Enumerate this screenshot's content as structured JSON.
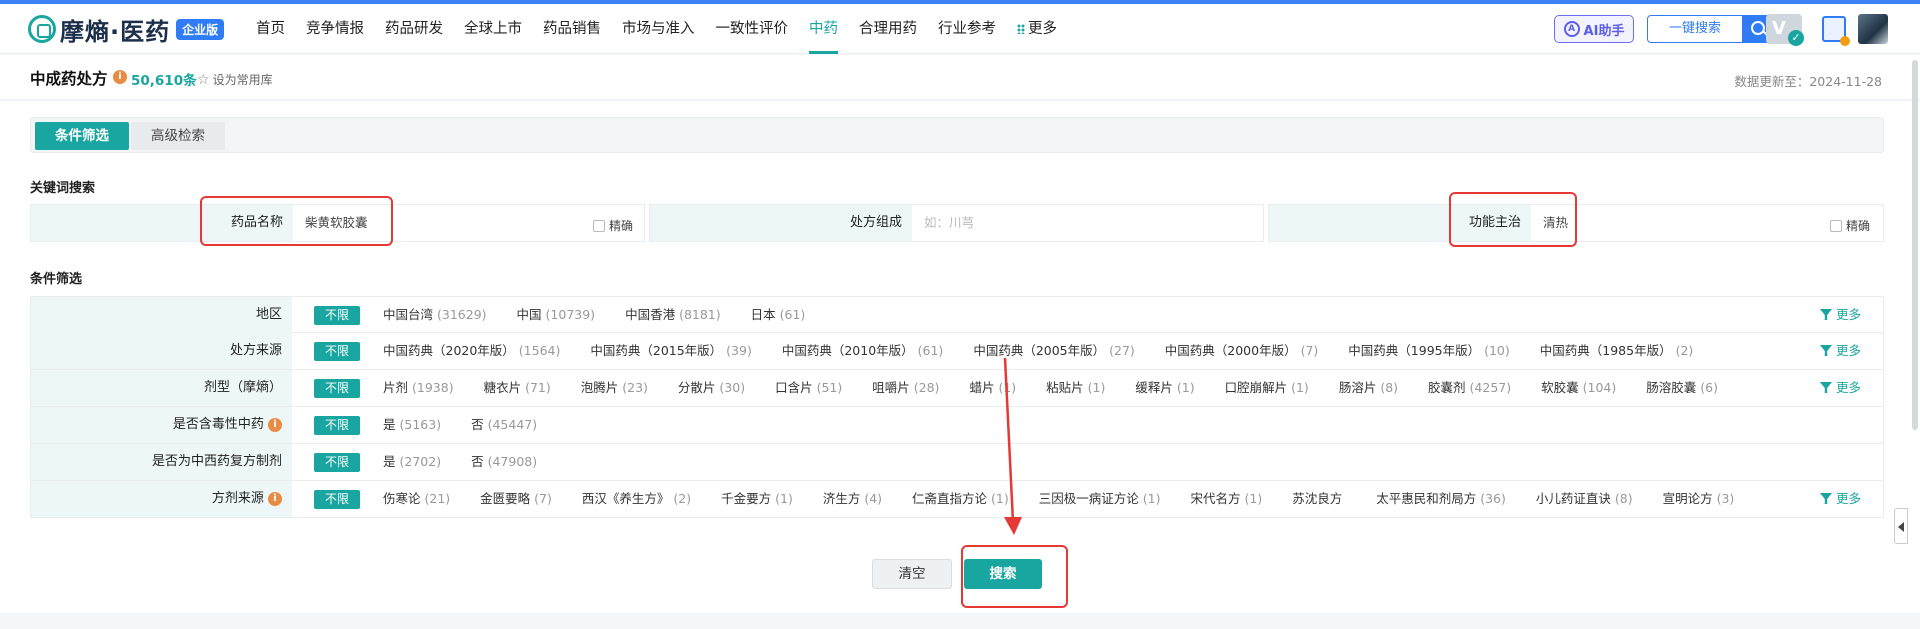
{
  "brand": {
    "name": "摩熵·医药",
    "edition": "企业版"
  },
  "nav": {
    "items": [
      "首页",
      "竞争情报",
      "药品研发",
      "全球上市",
      "药品销售",
      "市场与准入",
      "一致性评价",
      "中药",
      "合理用药",
      "行业参考"
    ],
    "active_index": 7,
    "more_label": "更多"
  },
  "tools": {
    "ai_label": "AI助手",
    "search_label": "一键搜索",
    "vip_label": "V"
  },
  "header": {
    "title": "中成药处方",
    "count": "50,610条",
    "favorite_label": "设为常用库",
    "update_text": "数据更新至：2024-11-28"
  },
  "tabs": [
    "条件筛选",
    "高级检索"
  ],
  "keyword_section": {
    "heading": "关键词搜索",
    "fields": [
      {
        "label": "药品名称",
        "value": "柴黄软胶囊",
        "exact_label": "精确"
      },
      {
        "label": "处方组成",
        "placeholder": "如：川芎"
      },
      {
        "label": "功能主治",
        "value": "清热",
        "exact_label": "精确"
      }
    ]
  },
  "filter_section": {
    "heading": "条件筛选",
    "unlimited_label": "不限",
    "more_label": "更多",
    "rows": [
      {
        "label": "地区",
        "info": false,
        "more": true,
        "options": [
          {
            "name": "中国台湾",
            "count": "(31629)"
          },
          {
            "name": "中国",
            "count": "(10739)"
          },
          {
            "name": "中国香港",
            "count": "(8181)"
          },
          {
            "name": "日本",
            "count": "(61)"
          }
        ]
      },
      {
        "label": "处方来源",
        "info": false,
        "more": true,
        "options": [
          {
            "name": "中国药典（2020年版）",
            "count": "(1564)"
          },
          {
            "name": "中国药典（2015年版）",
            "count": "(39)"
          },
          {
            "name": "中国药典（2010年版）",
            "count": "(61)"
          },
          {
            "name": "中国药典（2005年版）",
            "count": "(27)"
          },
          {
            "name": "中国药典（2000年版）",
            "count": "(7)"
          },
          {
            "name": "中国药典（1995年版）",
            "count": "(10)"
          },
          {
            "name": "中国药典（1985年版）",
            "count": "(2)"
          }
        ]
      },
      {
        "label": "剂型（摩熵）",
        "info": false,
        "more": true,
        "options": [
          {
            "name": "片剂",
            "count": "(1938)"
          },
          {
            "name": "糖衣片",
            "count": "(71)"
          },
          {
            "name": "泡腾片",
            "count": "(23)"
          },
          {
            "name": "分散片",
            "count": "(30)"
          },
          {
            "name": "口含片",
            "count": "(51)"
          },
          {
            "name": "咀嚼片",
            "count": "(28)"
          },
          {
            "name": "蜡片",
            "count": "(1)"
          },
          {
            "name": "粘贴片",
            "count": "(1)"
          },
          {
            "name": "缓释片",
            "count": "(1)"
          },
          {
            "name": "口腔崩解片",
            "count": "(1)"
          },
          {
            "name": "肠溶片",
            "count": "(8)"
          },
          {
            "name": "胶囊剂",
            "count": "(4257)"
          },
          {
            "name": "软胶囊",
            "count": "(104)"
          },
          {
            "name": "肠溶胶囊",
            "count": "(6)"
          }
        ]
      },
      {
        "label": "是否含毒性中药",
        "info": true,
        "more": false,
        "options": [
          {
            "name": "是",
            "count": "(5163)"
          },
          {
            "name": "否",
            "count": "(45447)"
          }
        ]
      },
      {
        "label": "是否为中西药复方制剂",
        "info": false,
        "more": false,
        "options": [
          {
            "name": "是",
            "count": "(2702)"
          },
          {
            "name": "否",
            "count": "(47908)"
          }
        ]
      },
      {
        "label": "方剂来源",
        "info": true,
        "more": true,
        "options": [
          {
            "name": "伤寒论",
            "count": "(21)"
          },
          {
            "name": "金匮要略",
            "count": "(7)"
          },
          {
            "name": "西汉《养生方》",
            "count": "(2)"
          },
          {
            "name": "千金要方",
            "count": "(1)"
          },
          {
            "name": "济生方",
            "count": "(4)"
          },
          {
            "name": "仁斋直指方论",
            "count": "(1)"
          },
          {
            "name": "三因极一病证方论",
            "count": "(1)"
          },
          {
            "name": "宋代名方",
            "count": "(1)"
          },
          {
            "name": "苏沈良方",
            "count": ""
          },
          {
            "name": "太平惠民和剂局方",
            "count": "(36)"
          },
          {
            "name": "小儿药证直诀",
            "count": "(8)"
          },
          {
            "name": "宣明论方",
            "count": "(3)"
          }
        ]
      }
    ]
  },
  "actions": {
    "clear_label": "清空",
    "search_label": "搜索"
  },
  "annotations": {
    "color": "#e53935"
  },
  "colors": {
    "accent": "#1aa6a0",
    "brand_blue": "#2f7cf6"
  }
}
